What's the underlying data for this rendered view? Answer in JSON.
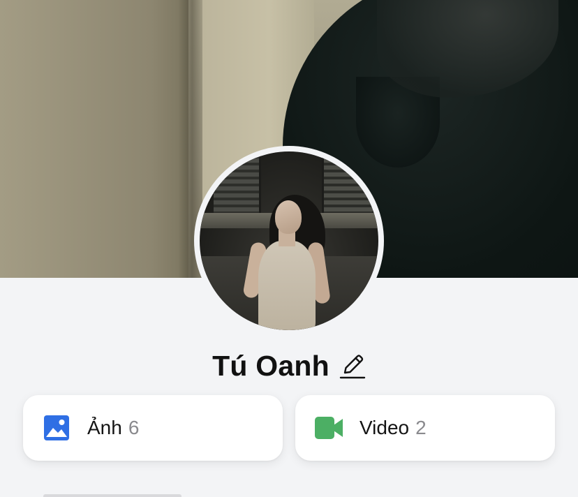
{
  "profile": {
    "name": "Tú Oanh"
  },
  "icons": {
    "edit": "pencil-icon",
    "photos": "image-icon",
    "videos": "video-camera-icon"
  },
  "media": {
    "photos": {
      "label": "Ảnh",
      "count": "6"
    },
    "videos": {
      "label": "Video",
      "count": "2"
    }
  },
  "colors": {
    "background": "#f3f4f6",
    "photo_icon": "#2f6fe4",
    "video_icon": "#4caf64",
    "count_text": "#8a8a8e"
  }
}
